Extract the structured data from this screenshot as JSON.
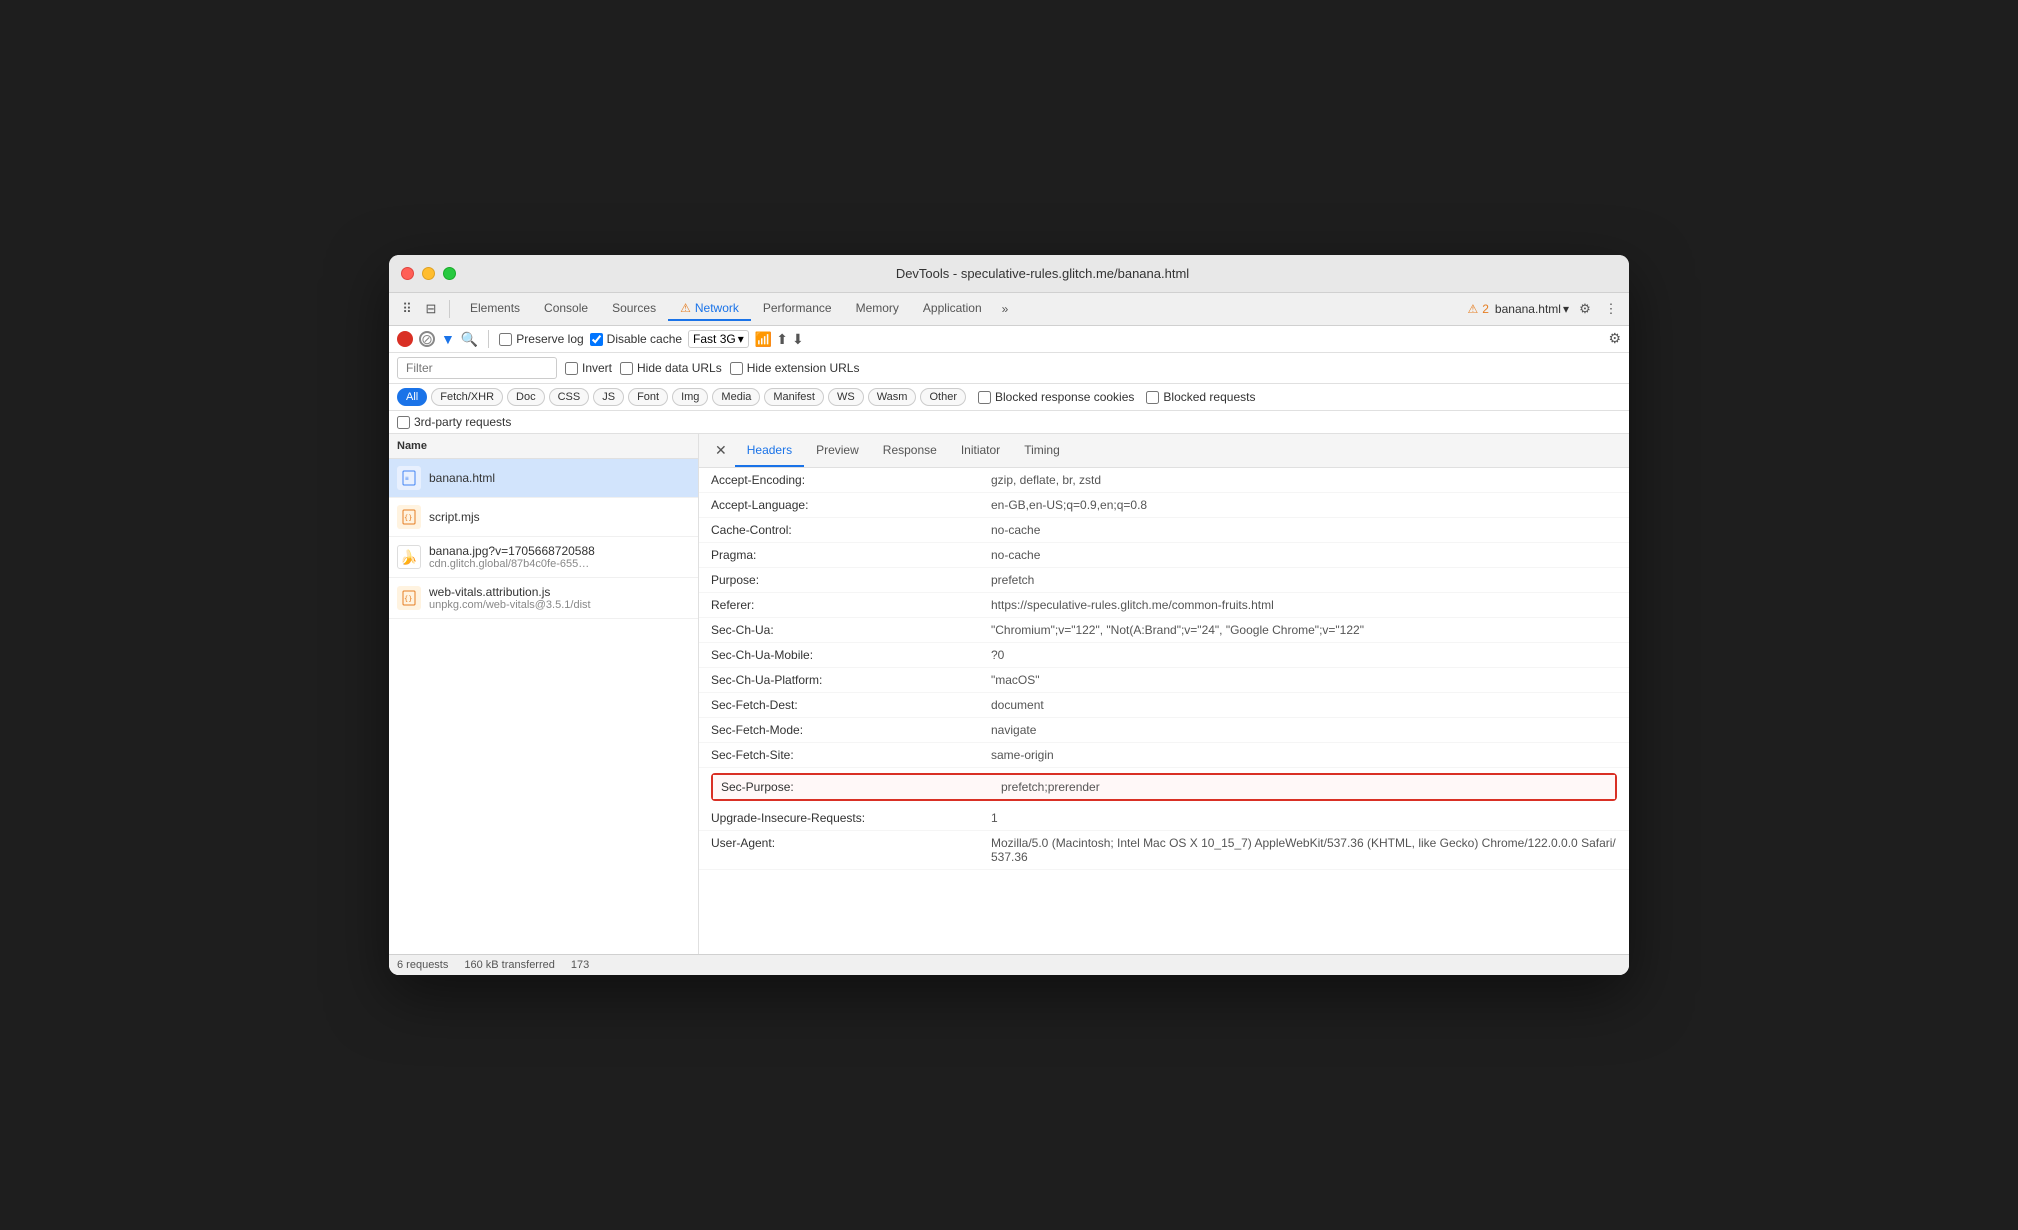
{
  "window": {
    "title": "DevTools - speculative-rules.glitch.me/banana.html"
  },
  "devtools": {
    "tabs": [
      {
        "label": "Elements",
        "active": false
      },
      {
        "label": "Console",
        "active": false
      },
      {
        "label": "Sources",
        "active": false
      },
      {
        "label": "⚠ Network",
        "active": true
      },
      {
        "label": "Performance",
        "active": false
      },
      {
        "label": "Memory",
        "active": false
      },
      {
        "label": "Application",
        "active": false
      },
      {
        "label": "»",
        "active": false
      }
    ],
    "warning_count": "2",
    "target": "banana.html"
  },
  "toolbar2": {
    "preserve_log_label": "Preserve log",
    "disable_cache_label": "Disable cache",
    "throttle_value": "Fast 3G"
  },
  "filter": {
    "placeholder": "Filter",
    "invert_label": "Invert",
    "hide_data_urls_label": "Hide data URLs",
    "hide_ext_label": "Hide extension URLs"
  },
  "chips": [
    {
      "label": "All",
      "active": true
    },
    {
      "label": "Fetch/XHR",
      "active": false
    },
    {
      "label": "Doc",
      "active": false
    },
    {
      "label": "CSS",
      "active": false
    },
    {
      "label": "JS",
      "active": false
    },
    {
      "label": "Font",
      "active": false
    },
    {
      "label": "Img",
      "active": false
    },
    {
      "label": "Media",
      "active": false
    },
    {
      "label": "Manifest",
      "active": false
    },
    {
      "label": "WS",
      "active": false
    },
    {
      "label": "Wasm",
      "active": false
    },
    {
      "label": "Other",
      "active": false
    }
  ],
  "extra_filters": {
    "blocked_cookies_label": "Blocked response cookies",
    "blocked_requests_label": "Blocked requests",
    "third_party_label": "3rd-party requests"
  },
  "file_list": {
    "header": "Name",
    "files": [
      {
        "name": "banana.html",
        "sub": "",
        "type": "html",
        "selected": true
      },
      {
        "name": "script.mjs",
        "sub": "",
        "type": "js",
        "selected": false
      },
      {
        "name": "banana.jpg?v=1705668720588",
        "sub": "cdn.glitch.global/87b4c0fe-655…",
        "type": "img",
        "selected": false
      },
      {
        "name": "web-vitals.attribution.js",
        "sub": "unpkg.com/web-vitals@3.5.1/dist",
        "type": "js",
        "selected": false
      }
    ]
  },
  "headers_panel": {
    "tabs": [
      "Headers",
      "Preview",
      "Response",
      "Initiator",
      "Timing"
    ],
    "active_tab": "Headers",
    "headers": [
      {
        "name": "Accept-Encoding:",
        "value": "gzip, deflate, br, zstd"
      },
      {
        "name": "Accept-Language:",
        "value": "en-GB,en-US;q=0.9,en;q=0.8"
      },
      {
        "name": "Cache-Control:",
        "value": "no-cache"
      },
      {
        "name": "Pragma:",
        "value": "no-cache"
      },
      {
        "name": "Purpose:",
        "value": "prefetch"
      },
      {
        "name": "Referer:",
        "value": "https://speculative-rules.glitch.me/common-fruits.html"
      },
      {
        "name": "Sec-Ch-Ua:",
        "value": "\"Chromium\";v=\"122\", \"Not(A:Brand\";v=\"24\", \"Google Chrome\";v=\"122\""
      },
      {
        "name": "Sec-Ch-Ua-Mobile:",
        "value": "?0"
      },
      {
        "name": "Sec-Ch-Ua-Platform:",
        "value": "\"macOS\""
      },
      {
        "name": "Sec-Fetch-Dest:",
        "value": "document"
      },
      {
        "name": "Sec-Fetch-Mode:",
        "value": "navigate"
      },
      {
        "name": "Sec-Fetch-Site:",
        "value": "same-origin"
      },
      {
        "name": "Sec-Purpose:",
        "value": "prefetch;prerender",
        "highlighted": true
      },
      {
        "name": "Upgrade-Insecure-Requests:",
        "value": "1"
      },
      {
        "name": "User-Agent:",
        "value": "Mozilla/5.0 (Macintosh; Intel Mac OS X 10_15_7) AppleWebKit/537.36 (KHTML, like Gecko) Chrome/122.0.0.0 Safari/537.36"
      }
    ]
  },
  "status_bar": {
    "requests": "6 requests",
    "transferred": "160 kB transferred",
    "size": "173"
  }
}
